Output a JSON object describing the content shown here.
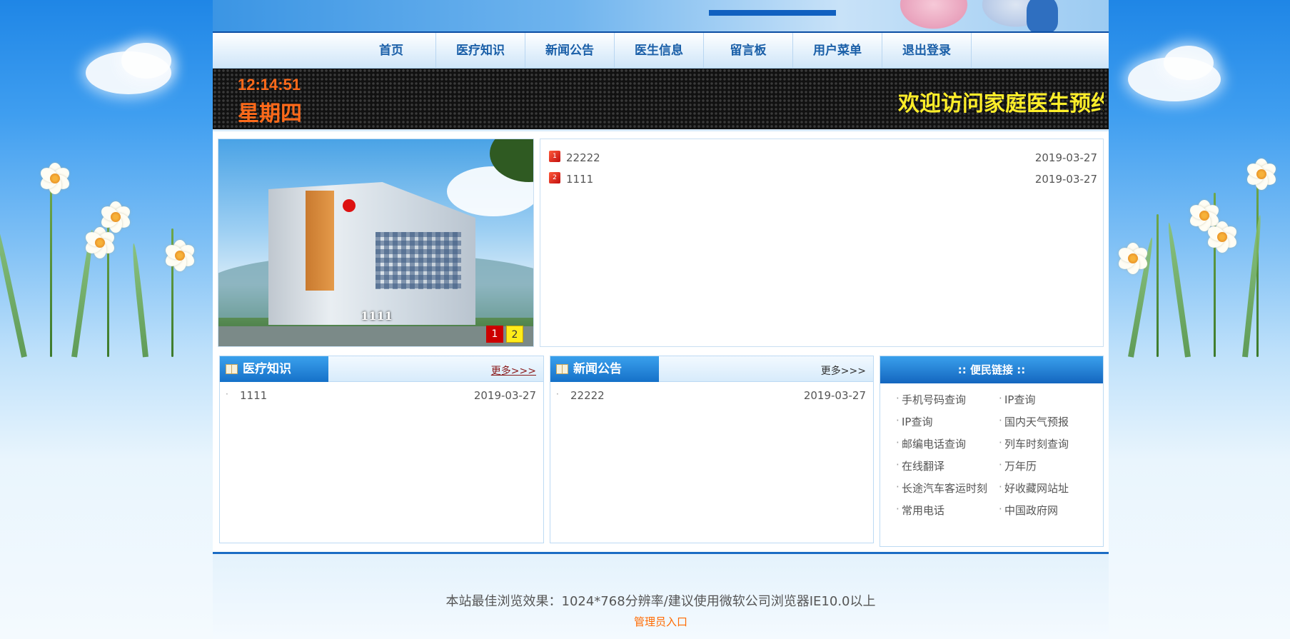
{
  "nav": {
    "items": [
      "首页",
      "医疗知识",
      "新闻公告",
      "医生信息",
      "留言板",
      "用户菜单",
      "退出登录"
    ]
  },
  "led": {
    "time": "12:14:51",
    "day": "星期四",
    "marquee": "欢迎访问家庭医生预约"
  },
  "slideshow": {
    "caption": "1111",
    "pages": [
      "1",
      "2"
    ],
    "active_page": 1
  },
  "top_news": [
    {
      "icon": "1",
      "title": "22222",
      "date": "2019-03-27"
    },
    {
      "icon": "2",
      "title": "1111",
      "date": "2019-03-27"
    }
  ],
  "panel_knowledge": {
    "title": "医疗知识",
    "more": "更多>>>",
    "items": [
      {
        "title": "1111",
        "date": "2019-03-27"
      }
    ]
  },
  "panel_news": {
    "title": "新闻公告",
    "more": "更多>>>",
    "items": [
      {
        "title": "22222",
        "date": "2019-03-27"
      }
    ]
  },
  "links": {
    "title": ":: 便民链接 ::",
    "items": [
      "手机号码查询",
      "IP查询",
      "IP查询",
      "国内天气预报",
      "邮编电话查询",
      "列车时刻查询",
      "在线翻译",
      "万年历",
      "长途汽车客运时刻",
      "好收藏网站址",
      "常用电话",
      "中国政府网"
    ]
  },
  "footer": {
    "note": "本站最佳浏览效果：1024*768分辨率/建议使用微软公司浏览器IE10.0以上",
    "admin": "管理员入口"
  },
  "colors": {
    "nav_text": "#1a5fa8",
    "led_orange": "#ff6a1a",
    "led_yellow": "#ffee2a",
    "tab_blue": "#1571c9",
    "footer_accent": "#ff6a00"
  }
}
